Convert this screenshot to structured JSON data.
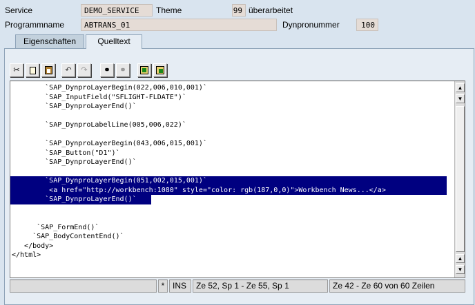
{
  "header": {
    "service_label": "Service",
    "service_value": "DEMO_SERVICE",
    "theme_label": "Theme",
    "theme_value": "99",
    "status_text": "überarbeitet",
    "programmname_label": "Programmname",
    "programmname_value": "ABTRANS_01",
    "dynpronummer_label": "Dynpronummer",
    "dynpronummer_value": "100"
  },
  "tabs": [
    {
      "label": "Eigenschaften",
      "active": false
    },
    {
      "label": "Quelltext",
      "active": true
    }
  ],
  "toolbar": [
    {
      "icon": "scissors-icon",
      "name": "cut-button"
    },
    {
      "icon": "new-page-icon",
      "name": "copy-button"
    },
    {
      "icon": "clipboard-icon",
      "name": "paste-button"
    },
    {
      "icon": "undo-icon",
      "name": "undo-button"
    },
    {
      "icon": "redo-icon",
      "name": "redo-button"
    },
    {
      "icon": "binoculars-icon",
      "name": "find-button"
    },
    {
      "icon": "binoculars-next-icon",
      "name": "find-next-button"
    },
    {
      "icon": "upload-icon",
      "name": "upload-button"
    },
    {
      "icon": "download-icon",
      "name": "download-button"
    }
  ],
  "code_lines": [
    "        `SAP_DynproLayerBegin(022,006,010,001)`",
    "        `SAP_InputField(\"SFLIGHT-FLDATE\")`",
    "        `SAP_DynproLayerEnd()`",
    "",
    "        `SAP_DynproLabelLine(005,006,022)`",
    "",
    "        `SAP_DynproLayerBegin(043,006,015,001)`",
    "        `SAP_Button(\"D1\")`",
    "        `SAP_DynproLayerEnd()`",
    "",
    "        `SAP_DynproLayerBegin(051,002,015,001)`",
    "         <a href=\"http://workbench:1080\" style=\"color: rgb(187,0,0)\">Workbench News...</a>",
    "        `SAP_DynproLayerEnd()`",
    "",
    "",
    "      `SAP_FormEnd()`",
    "     `SAP_BodyContentEnd()`",
    "   </body>",
    "</html>"
  ],
  "selection": {
    "first_line": 11,
    "last_line": 13
  },
  "statusbar": {
    "field1": "",
    "modified_marker": "*",
    "mode": "INS",
    "selection_range": "Ze 52, Sp 1 - Ze 55, Sp 1",
    "line_info": "Ze 42 - Ze 60 von 60 Zeilen"
  },
  "colors": {
    "background": "#d9e4ef",
    "selection": "#000080",
    "field": "#e5dcd6"
  }
}
